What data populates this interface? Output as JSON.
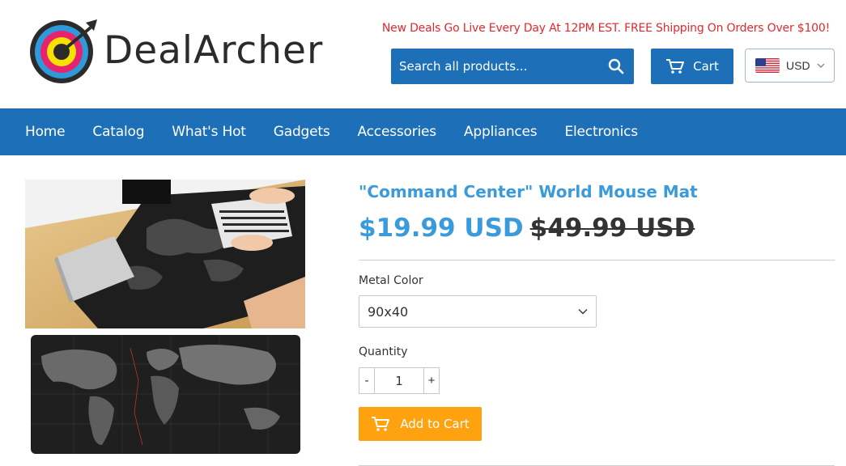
{
  "header": {
    "logo_text": "DealArcher",
    "promo": "New Deals Go Live Every Day At 12PM EST. FREE Shipping On Orders Over $100!",
    "search_placeholder": "Search all products...",
    "cart_label": "Cart",
    "currency": "USD"
  },
  "nav": {
    "items": [
      "Home",
      "Catalog",
      "What's Hot",
      "Gadgets",
      "Accessories",
      "Appliances",
      "Electronics"
    ]
  },
  "product": {
    "title": "\"Command Center\" World Mouse Mat",
    "price": "$19.99 USD",
    "compare_price": "$49.99 USD",
    "option_label": "Metal Color",
    "option_value": "90x40",
    "quantity_label": "Quantity",
    "quantity": "1",
    "minus_label": "-",
    "plus_label": "+",
    "add_to_cart_label": "Add to Cart"
  },
  "colors": {
    "brand_blue": "#1d70b8",
    "title_blue": "#3a9bdc",
    "promo_red": "#e4282d",
    "add_to_cart_orange": "#ffa20f"
  },
  "icons": {
    "search": "search-icon",
    "cart": "cart-icon",
    "flag": "us-flag-icon",
    "dropdown": "chevron-down-icon"
  }
}
